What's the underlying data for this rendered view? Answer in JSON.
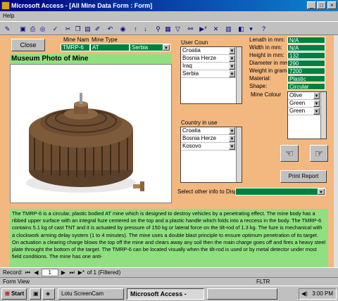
{
  "window": {
    "title": "Microsoft Access - [All Mine Data Form : Form]"
  },
  "menu": {
    "help": "Help"
  },
  "form": {
    "close_label": "Close",
    "mine_name_header": "Mine Nam",
    "mine_type_header": "Mine Type",
    "mine_name": "TMRP-6",
    "mine_type": "AT",
    "mine_country": "Serbia",
    "photo_title": "Museum Photo of Mine",
    "user_country_label": "User Coun",
    "user_countries": [
      "Croatia",
      "Bosnia Herze",
      "Iraq",
      "Serbia"
    ],
    "country_in_use_label": "Country in use",
    "countries_in_use": [
      "Croatia",
      "Bosnia Herze",
      "Kosovo"
    ],
    "specs": [
      {
        "label": "Lenath in mm:",
        "value": "N/A"
      },
      {
        "label": "Width in mm:",
        "value": "N/A"
      },
      {
        "label": "Height in mm:",
        "value": "132"
      },
      {
        "label": "Diameter in mm:",
        "value": "290"
      },
      {
        "label": "Weight in grams:",
        "value": "7200"
      },
      {
        "label": "Material:",
        "value": "Plastic"
      },
      {
        "label": "Shape:",
        "value": "Circular"
      }
    ],
    "mine_colour_label": "Mine Colour",
    "colours": [
      "Olive",
      "Green",
      "Green"
    ],
    "print_report_label": "Print Report",
    "select_other_label": "Select other info to Disp",
    "description": "The TMRP-6 is a circular, plastic bodied AT mine which is designed to destroy vehicles by a penetrating effect. The mine body has a ribbed upper surface with an integral fuze centered on the top and a plastic handle which folds into a reccess in the body. The TMRP-6 contains 5.1 kg of cast TNT and it is actuated by pressure of 150 kg or lateral force on the tilt-rod of 1.3 kg. The fuze is mechanical with a clockwork arming delay system (1 to 4 minutes). The mine uses a double blast principle to ensure optimum penetration of its target. On actuation a clearing charge blows the top off the mine and clears away any soil then the main charge goes off and fires a heavy steel plate throught the bottom of the target. The TMRP-6 can be located visually when the tilt-rod is used or by metal detector under most field conditions. The mine has one anti-"
  },
  "record_bar": {
    "label": "Record:",
    "current": "1",
    "of_text": "of 1 (Filtered)"
  },
  "status": {
    "left": "Form View",
    "mode": "FLTR"
  },
  "taskbar": {
    "start": "Start",
    "tasks": [
      "Lotu ScreenCam",
      "Microsoft Access -",
      ""
    ],
    "clock": "3:00 PM"
  }
}
